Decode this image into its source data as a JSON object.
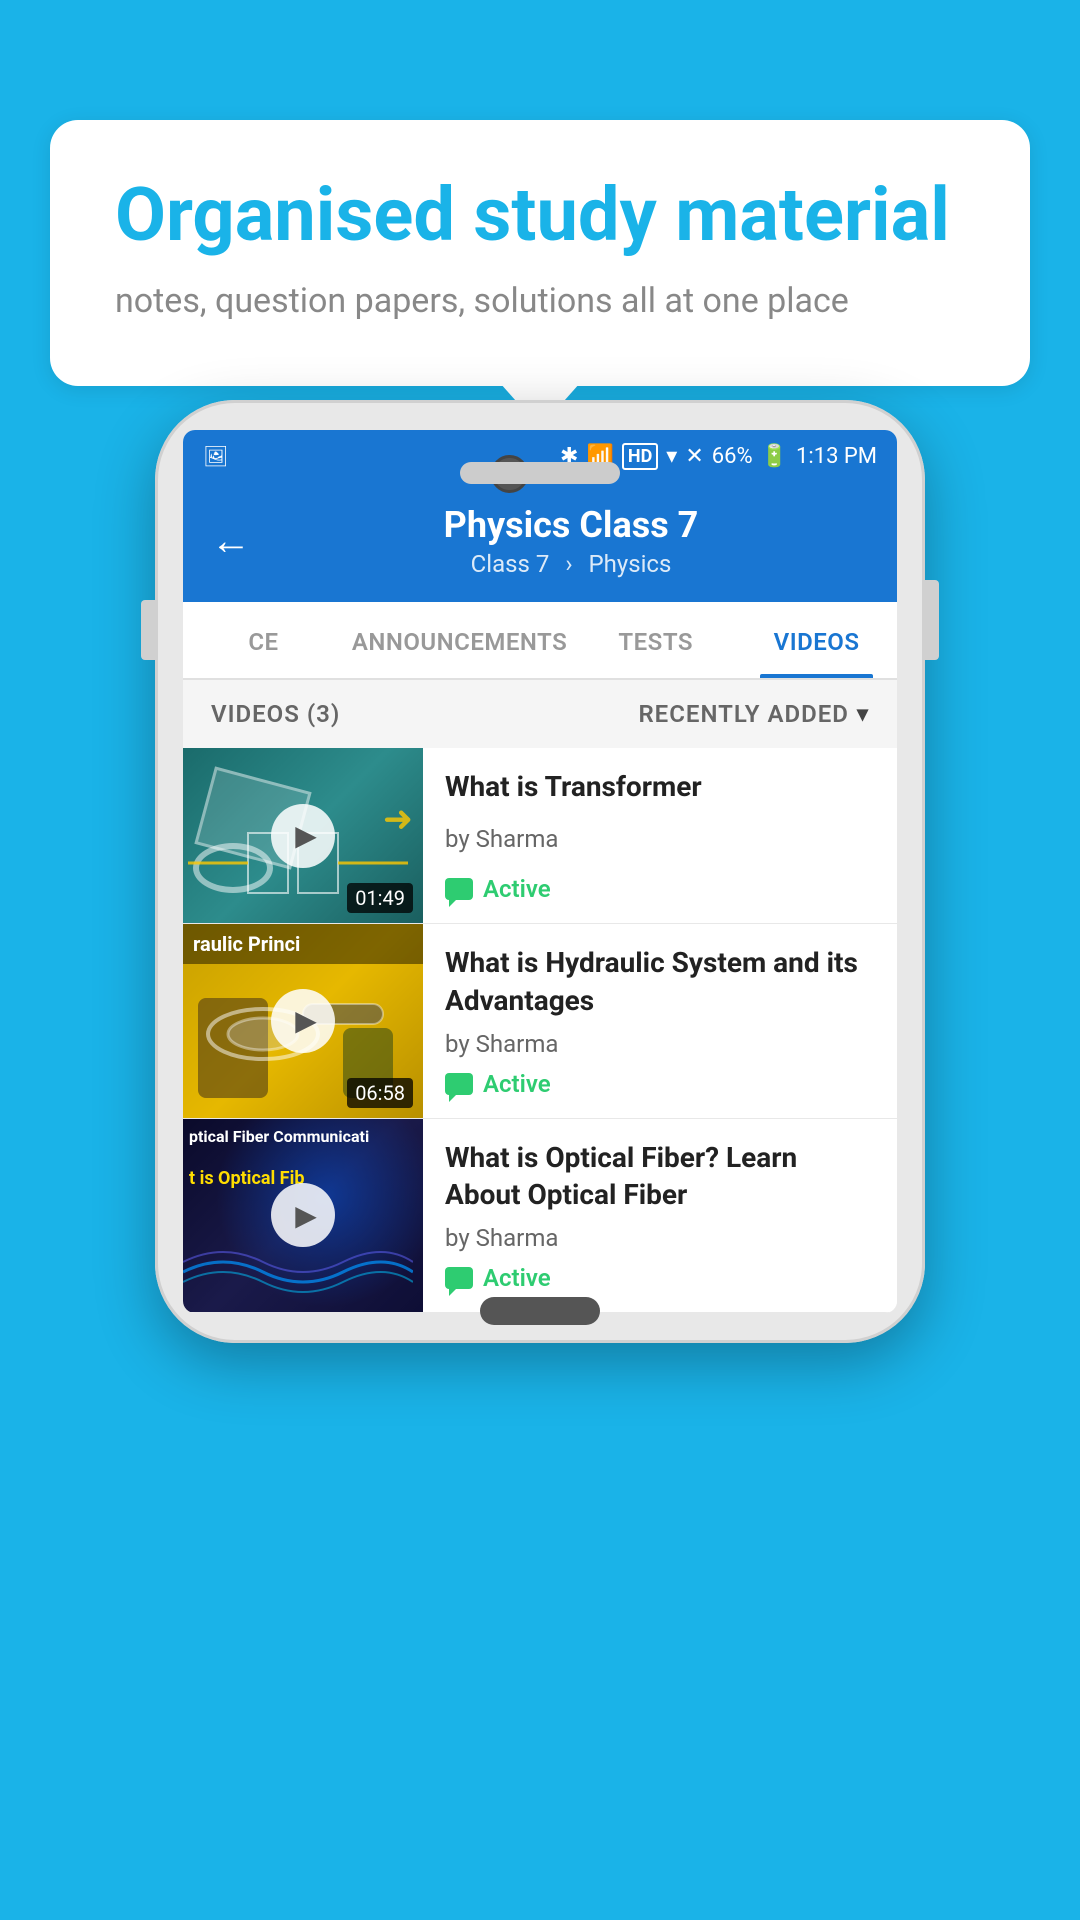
{
  "bubble": {
    "title": "Organised study material",
    "subtitle": "notes, question papers, solutions all at one place"
  },
  "status_bar": {
    "battery": "66%",
    "time": "1:13 PM"
  },
  "header": {
    "title": "Physics Class 7",
    "breadcrumb_class": "Class 7",
    "breadcrumb_subject": "Physics",
    "back_label": "←"
  },
  "tabs": [
    {
      "id": "ce",
      "label": "CE",
      "active": false
    },
    {
      "id": "announcements",
      "label": "ANNOUNCEMENTS",
      "active": false
    },
    {
      "id": "tests",
      "label": "TESTS",
      "active": false
    },
    {
      "id": "videos",
      "label": "VIDEOS",
      "active": true
    }
  ],
  "videos_section": {
    "count_label": "VIDEOS (3)",
    "sort_label": "RECENTLY ADDED"
  },
  "videos": [
    {
      "id": "v1",
      "title": "What is  Transformer",
      "author": "by Sharma",
      "status": "Active",
      "duration": "01:49",
      "thumb_type": "transformer"
    },
    {
      "id": "v2",
      "title": "What is Hydraulic System and its Advantages",
      "author": "by Sharma",
      "status": "Active",
      "duration": "06:58",
      "thumb_type": "hydraulic",
      "thumb_text": "raulic Princi"
    },
    {
      "id": "v3",
      "title": "What is Optical Fiber? Learn About Optical Fiber",
      "author": "by Sharma",
      "status": "Active",
      "duration": "",
      "thumb_type": "optical",
      "thumb_text1": "ptical Fiber Communicati",
      "thumb_text2": "t is Optical Fib"
    }
  ],
  "icons": {
    "play": "▶",
    "chevron_down": "▾",
    "back": "←"
  }
}
